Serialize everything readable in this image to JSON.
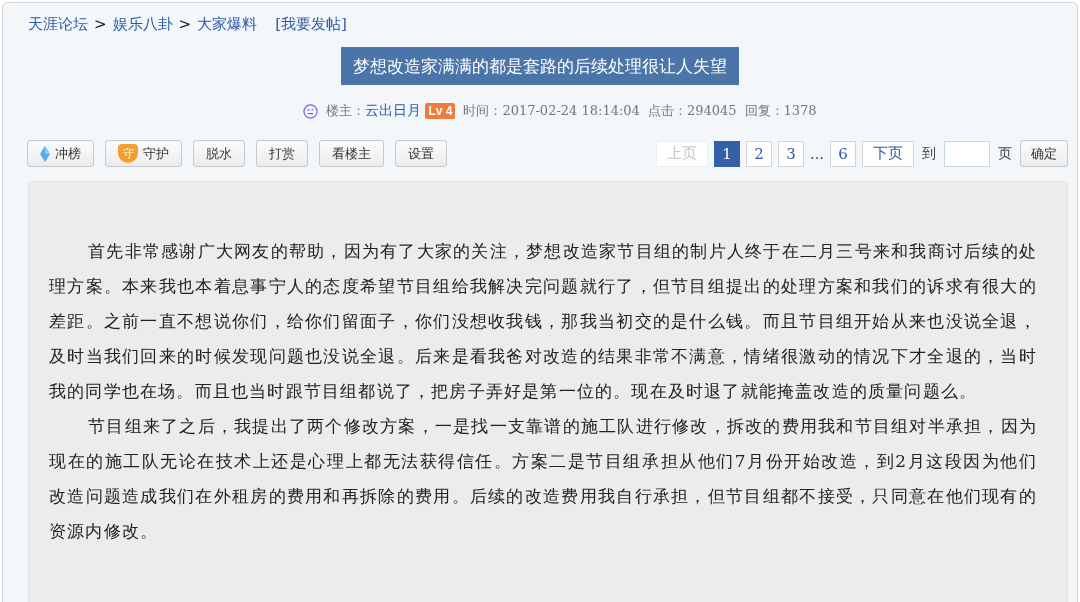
{
  "breadcrumb": {
    "items": [
      "天涯论坛",
      "娱乐八卦",
      "大家爆料"
    ],
    "separator": ">",
    "post_link": "[我要发帖]"
  },
  "title": "梦想改造家满满的都是套路的后续处理很让人失望",
  "meta": {
    "author_label": "楼主：",
    "author": "云出日月",
    "level": "Lv 4",
    "time_label": "时间：",
    "time": "2017-02-24 18:14:04",
    "clicks_label": "点击：",
    "clicks": "294045",
    "replies_label": "回复：",
    "replies": "1378"
  },
  "toolbar": [
    {
      "label": "冲榜",
      "kind": "diamond"
    },
    {
      "label": "守护",
      "kind": "shield",
      "icon_text": "守"
    },
    {
      "label": "脱水",
      "kind": "plain"
    },
    {
      "label": "打赏",
      "kind": "plain"
    },
    {
      "label": "看楼主",
      "kind": "plain"
    },
    {
      "label": "设置",
      "kind": "plain"
    }
  ],
  "pagination": {
    "prev": {
      "label": "上页",
      "disabled": true
    },
    "pages": [
      {
        "label": "1",
        "selected": true
      },
      {
        "label": "2",
        "selected": false
      },
      {
        "label": "3",
        "selected": false
      },
      {
        "label": "…",
        "kind": "ellipsis"
      },
      {
        "label": "6",
        "selected": false
      }
    ],
    "next": {
      "label": "下页",
      "disabled": false
    },
    "goto_label": "到",
    "page_unit": "页",
    "confirm": "确定"
  },
  "paragraphs": [
    "首先非常感谢广大网友的帮助，因为有了大家的关注，梦想改造家节目组的制片人终于在二月三号来和我商讨后续的处理方案。本来我也本着息事宁人的态度希望节目组给我解决完问题就行了，但节目组提出的处理方案和我们的诉求有很大的差距。之前一直不想说你们，给你们留面子，你们没想收我钱，那我当初交的是什么钱。而且节目组开始从来也没说全退，及时当我们回来的时候发现问题也没说全退。后来是看我爸对改造的结果非常不满意，情绪很激动的情况下才全退的，当时我的同学也在场。而且也当时跟节目组都说了，把房子弄好是第一位的。现在及时退了就能掩盖改造的质量问题么。",
    "节目组来了之后，我提出了两个修改方案，一是找一支靠谱的施工队进行修改，拆改的费用我和节目组对半承担，因为现在的施工队无论在技术上还是心理上都无法获得信任。方案二是节目组承担从他们7月份开始改造，到2月这段因为他们改造问题造成我们在外租房的费用和再拆除的费用。后续的改造费用我自行承担，但节目组都不接受，只同意在他们现有的资源内修改。"
  ]
}
